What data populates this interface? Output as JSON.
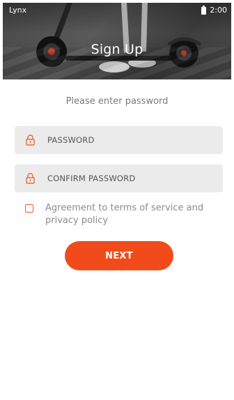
{
  "status_bar": {
    "carrier": "Lynx",
    "time": "2:00"
  },
  "header": {
    "title": "Sign Up"
  },
  "form": {
    "subtitle": "Please enter password",
    "password_placeholder": "PASSWORD",
    "confirm_placeholder": "CONFIRM PASSWORD",
    "agreement_text": "Agreement to terms of service and privacy policy",
    "agreement_checked": false,
    "next_label": "NEXT"
  },
  "colors": {
    "accent": "#f24b1b",
    "field_bg": "#ebebeb"
  },
  "icons": {
    "field_icon": "lock-icon",
    "battery": "battery-icon"
  }
}
